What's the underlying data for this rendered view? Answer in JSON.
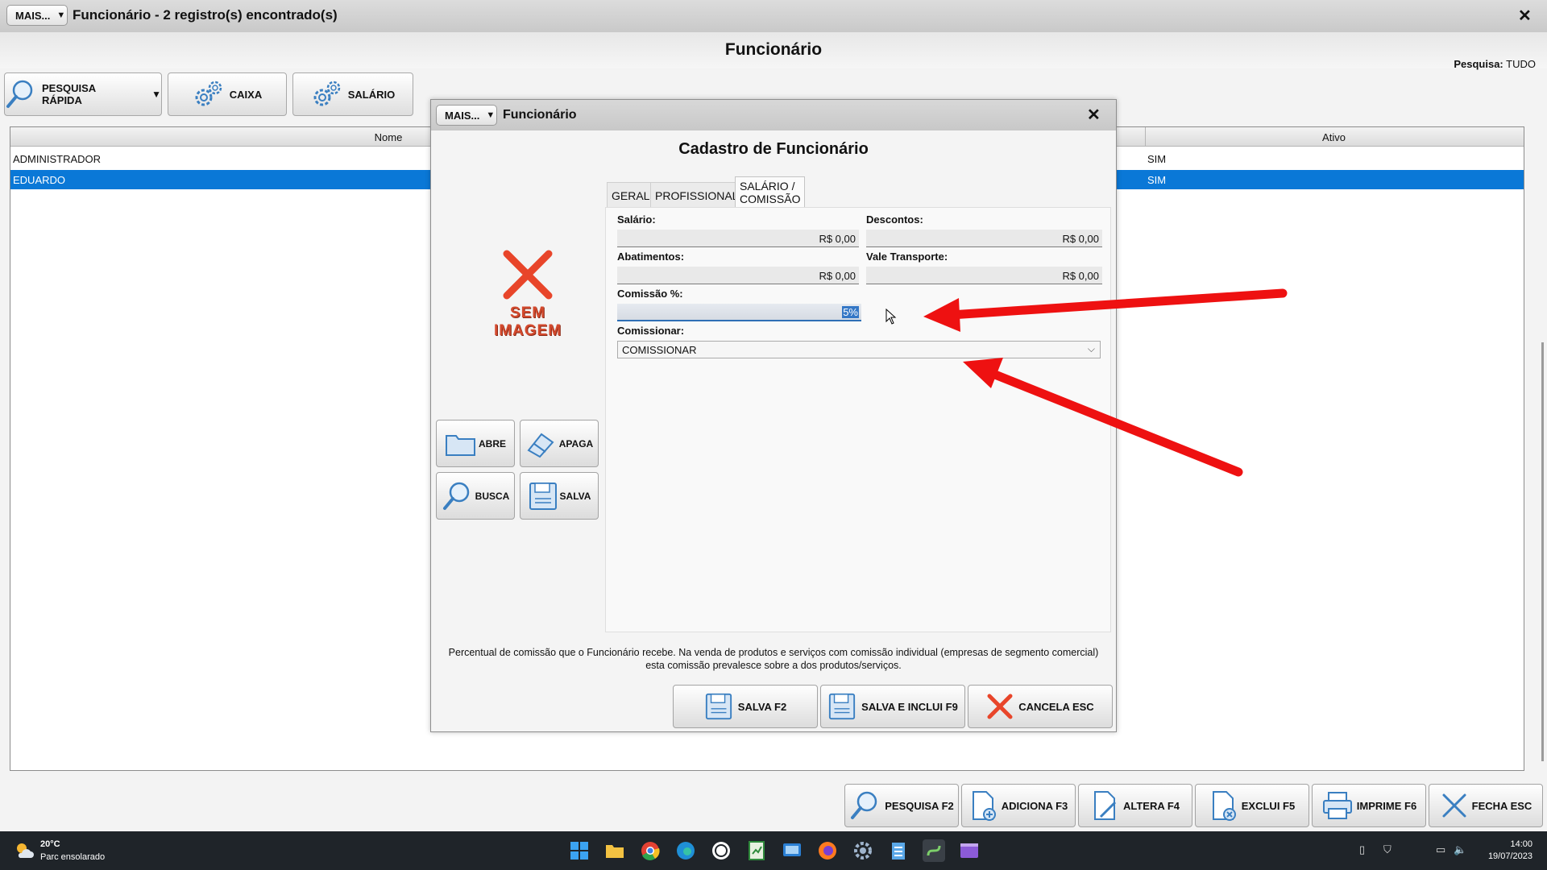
{
  "main": {
    "mais_label": "MAIS...",
    "title": "Funcionário - 2 registro(s) encontrado(s)",
    "heading": "Funcionário",
    "pesquisa_label": "Pesquisa:",
    "pesquisa_value": "TUDO",
    "toolbar": {
      "pesquisa_rapida": "PESQUISA RÁPIDA",
      "caixa": "CAIXA",
      "salario": "SALÁRIO"
    }
  },
  "grid": {
    "columns": [
      "Nome",
      "Ativo"
    ],
    "rows": [
      {
        "nome": "ADMINISTRADOR",
        "ativo": "SIM"
      },
      {
        "nome": "EDUARDO",
        "ativo": "SIM"
      }
    ]
  },
  "dialog": {
    "mais_label": "MAIS...",
    "title": "Funcionário",
    "heading": "Cadastro de Funcionário",
    "sem_imagem_line1": "SEM",
    "sem_imagem_line2": "IMAGEM",
    "side_buttons": {
      "abre": "ABRE",
      "apaga": "APAGA",
      "busca": "BUSCA",
      "salva": "SALVA"
    },
    "tabs": [
      "GERAL",
      "PROFISSIONAL",
      "SALÁRIO / COMISSÃO"
    ],
    "fields": {
      "salario_label": "Salário:",
      "salario_value": "R$ 0,00",
      "descontos_label": "Descontos:",
      "descontos_value": "R$ 0,00",
      "abatimentos_label": "Abatimentos:",
      "abatimentos_value": "R$ 0,00",
      "vale_label": "Vale Transporte:",
      "vale_value": "R$ 0,00",
      "comissao_label": "Comissão %:",
      "comissao_value": "5%",
      "comissionar_label": "Comissionar:",
      "comissionar_value": "COMISSIONAR"
    },
    "hint_line1": "Percentual de comissão que o Funcionário recebe. Na venda de produtos e serviços com comissão individual (empresas de segmento comercial)",
    "hint_line2": "esta comissão prevalesce sobre a dos produtos/serviços.",
    "footer": {
      "salva": "SALVA F2",
      "salva_inclui": "SALVA E INCLUI F9",
      "cancela": "CANCELA ESC"
    }
  },
  "bottom_bar": {
    "pesquisa": "PESQUISA F2",
    "adiciona": "ADICIONA F3",
    "altera": "ALTERA F4",
    "exclui": "EXCLUI F5",
    "imprime": "IMPRIME F6",
    "fecha": "FECHA ESC"
  },
  "taskbar": {
    "temperature": "20°C",
    "weather": "Parc ensolarado",
    "time": "14:00",
    "date": "19/07/2023"
  },
  "colors": {
    "selection": "#0a78d7",
    "annotation_arrow": "#ee1111",
    "sem_imagem": "#d44a2e"
  }
}
